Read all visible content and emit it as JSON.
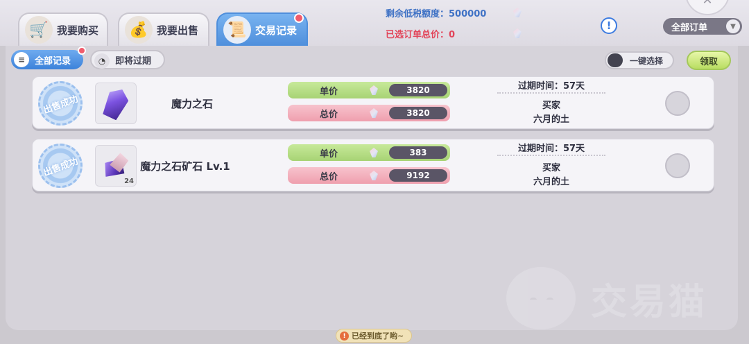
{
  "tabs": [
    {
      "label": "我要购买",
      "icon": "cart-icon"
    },
    {
      "label": "我要出售",
      "icon": "money-bag-icon"
    },
    {
      "label": "交易记录",
      "icon": "records-scroll-icon",
      "active": true
    }
  ],
  "quota": {
    "remaining_label": "剩余低税额度：",
    "remaining_value": "500000",
    "selected_label": "已选订单总价：",
    "selected_value": "0"
  },
  "info_symbol": "!",
  "order_filter": {
    "selected": "全部订单"
  },
  "sub_tabs": [
    {
      "label": "全部记录",
      "icon": "list-icon",
      "active": true
    },
    {
      "label": "即将过期",
      "icon": "clock-icon",
      "active": false
    }
  ],
  "select_all_label": "一键选择",
  "claim_label": "领取",
  "records": [
    {
      "status": "出售成功",
      "item_name": "魔力之石",
      "item_icon": "magic-crystal-icon",
      "quantity": "",
      "unit_label": "单价",
      "unit_price": "3820",
      "total_label": "总价",
      "total_price": "3820",
      "expire": "过期时间：57天",
      "buyer_label": "买家",
      "buyer_name": "六月的土"
    },
    {
      "status": "出售成功",
      "item_name": "魔力之石矿石 Lv.1",
      "item_icon": "crystal-ore-icon",
      "quantity": "24",
      "unit_label": "单价",
      "unit_price": "383",
      "total_label": "总价",
      "total_price": "9192",
      "expire": "过期时间：57天",
      "buyer_label": "买家",
      "buyer_name": "六月的土"
    }
  ],
  "watermark_text": "交易猫",
  "footer_text": "已经到底了哟~",
  "colors": {
    "accent_blue": "#4f8fdc",
    "unit_green": "#a7d374",
    "total_pink": "#ef9fae",
    "quota_blue": "#3f72c5",
    "selected_red": "#e2455a"
  }
}
